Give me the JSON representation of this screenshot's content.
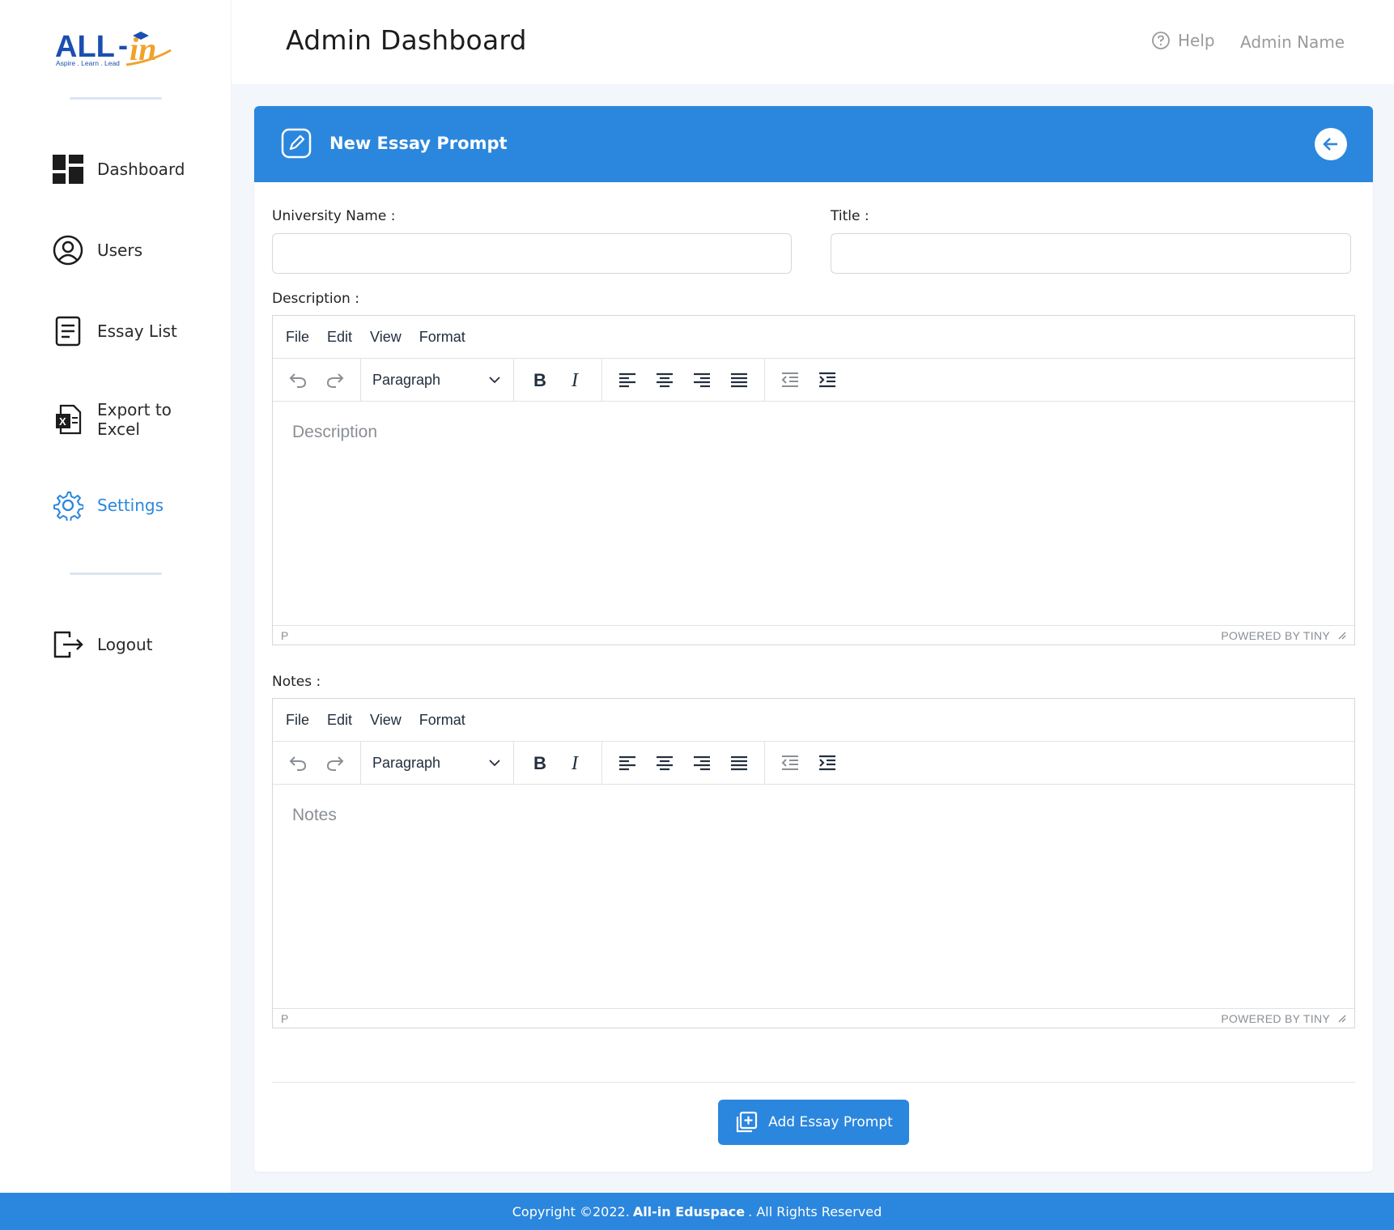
{
  "brand": {
    "logo_text": "ALL-in",
    "logo_tagline": "Aspire . Learn . Lead",
    "colors": {
      "primary": "#2b86dd",
      "accent": "#f0a22b",
      "logo_blue": "#1a4fb0"
    }
  },
  "sidebar": {
    "items": [
      {
        "label": "Dashboard",
        "icon": "dashboard-icon"
      },
      {
        "label": "Users",
        "icon": "user-circle-icon"
      },
      {
        "label": "Essay List",
        "icon": "document-list-icon"
      },
      {
        "label": "Export to\nExcel",
        "icon": "excel-icon"
      },
      {
        "label": "Settings",
        "icon": "gear-icon",
        "active": true
      },
      {
        "label": "Logout",
        "icon": "logout-icon"
      }
    ]
  },
  "header": {
    "title": "Admin Dashboard",
    "help_label": "Help",
    "admin_name": "Admin Name"
  },
  "form": {
    "card_title": "New Essay Prompt",
    "university_label": "University Name :",
    "title_label": "Title :",
    "description_label": "Description :",
    "notes_label": "Notes :",
    "submit_label": "Add Essay Prompt"
  },
  "editor": {
    "menu": [
      "File",
      "Edit",
      "View",
      "Format"
    ],
    "block_format": "Paragraph",
    "status_path": "P",
    "powered_by": "POWERED BY TINY",
    "description_placeholder": "Description",
    "notes_placeholder": "Notes"
  },
  "footer": {
    "prefix": "Copyright ©2022.",
    "brand": "All-in Eduspace",
    "suffix": ". All Rights Reserved"
  }
}
